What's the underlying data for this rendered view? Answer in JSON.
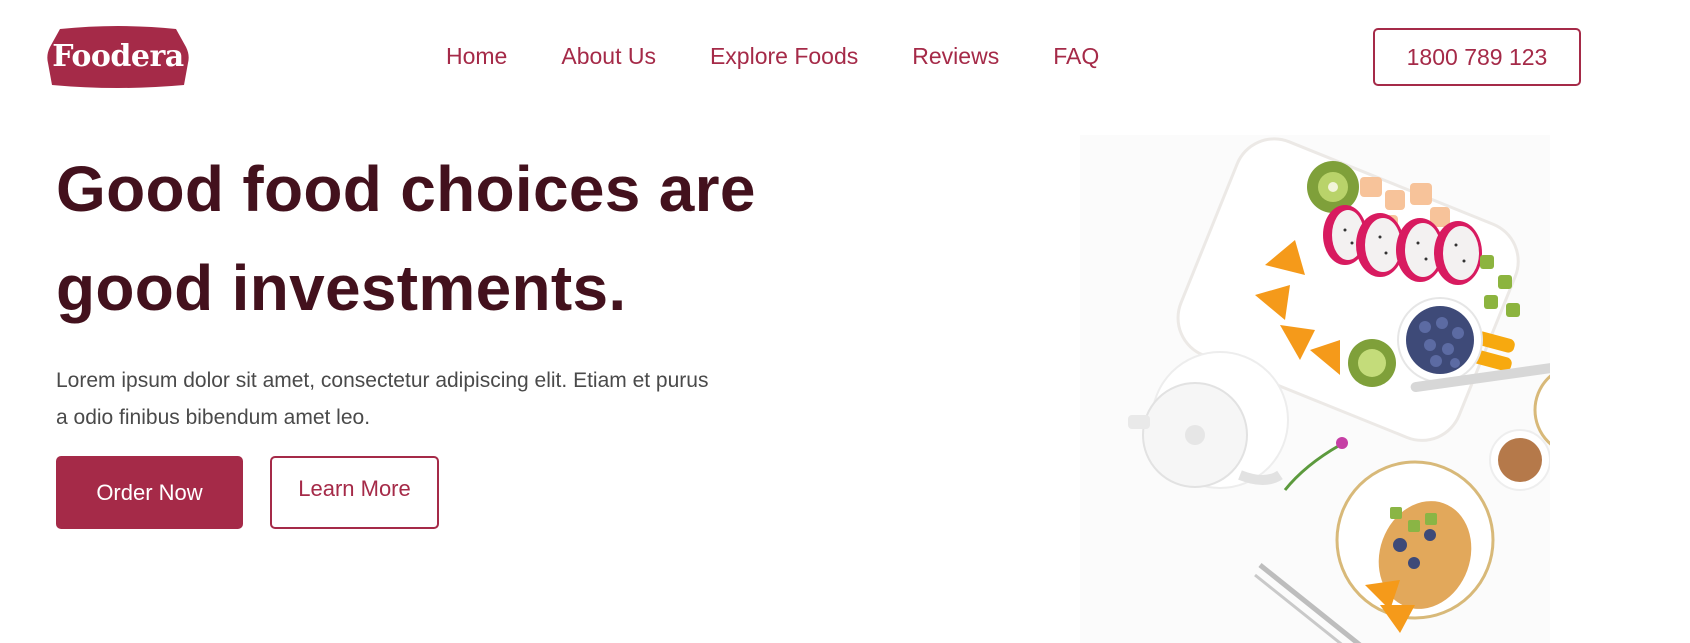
{
  "brand": {
    "name": "Foodera",
    "color": "#a52a48"
  },
  "nav": {
    "items": [
      {
        "label": "Home"
      },
      {
        "label": "About Us"
      },
      {
        "label": "Explore Foods"
      },
      {
        "label": "Reviews"
      },
      {
        "label": "FAQ"
      }
    ]
  },
  "header": {
    "phone": "1800 789 123"
  },
  "hero": {
    "headline_line1": "Good food choices are",
    "headline_line2": "good investments.",
    "lead_line1": "Lorem ipsum dolor sit amet, consectetur adipiscing elit. Etiam et purus",
    "lead_line2": "a odio finibus bibendum amet leo.",
    "primary_button": "Order Now",
    "secondary_button": "Learn More",
    "headline_color": "#43111d"
  }
}
